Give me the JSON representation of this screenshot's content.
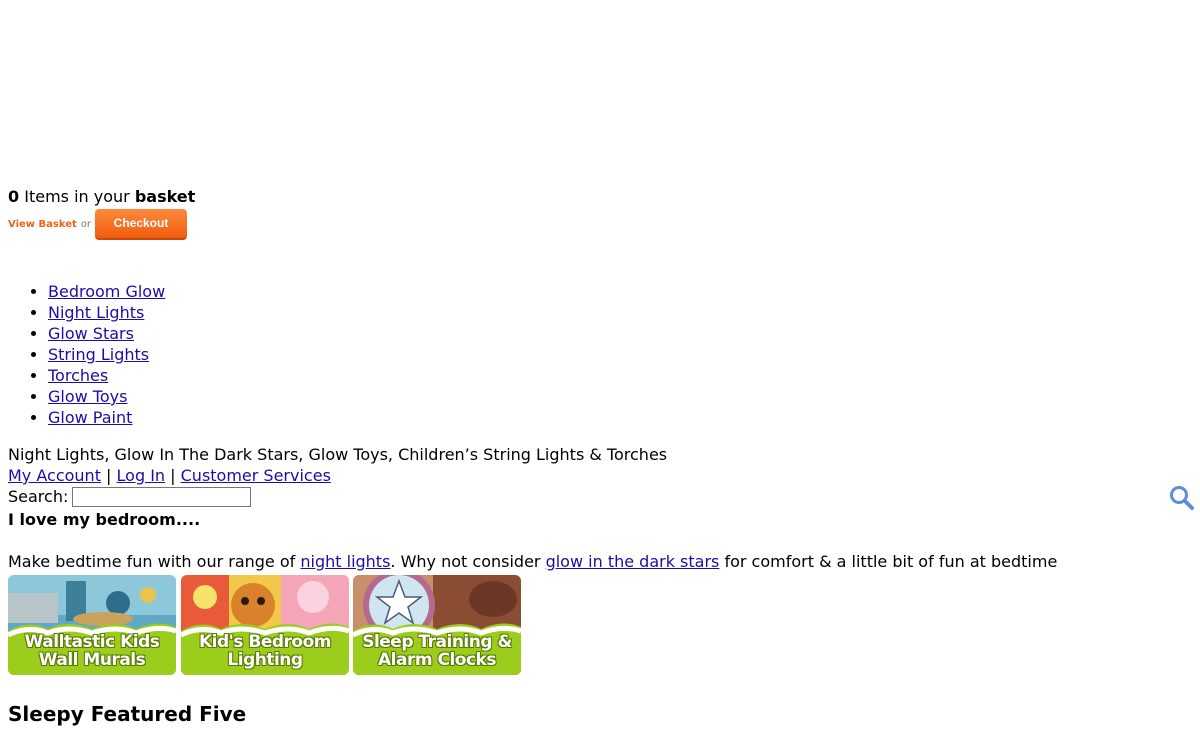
{
  "basket": {
    "count": "0",
    "items_text": " Items in your ",
    "basket_word": "basket",
    "view_basket": "View Basket",
    "or": "or",
    "checkout": "Checkout"
  },
  "nav": {
    "items": [
      "Bedroom Glow",
      "Night Lights",
      "Glow Stars",
      "String Lights",
      "Torches",
      "Glow Toys",
      "Glow Paint"
    ]
  },
  "tagline": "Night Lights, Glow In The Dark Stars, Glow Toys, Children’s String Lights & Torches",
  "account": {
    "my_account": "My Account",
    "separator": " | ",
    "log_in": "Log In",
    "customer_services": "Customer Services"
  },
  "search": {
    "label": "Search:",
    "value": "",
    "icon": "search-icon"
  },
  "intro": {
    "heading": "I love my bedroom....",
    "text_before": "Make bedtime fun with our range of ",
    "link_night_lights": "night lights",
    "text_middle": ". Why not consider ",
    "link_glow_stars": "glow in the dark stars",
    "text_after": " for comfort & a little bit of fun at bedtime"
  },
  "banners": [
    {
      "line1": "Walltastic Kids",
      "line2": "Wall Murals"
    },
    {
      "line1": "Kid's Bedroom",
      "line2": "Lighting"
    },
    {
      "line1": "Sleep Training &",
      "line2": "Alarm Clocks"
    }
  ],
  "featured": {
    "heading": "Sleepy Featured Five"
  },
  "colors": {
    "link": "#1a0dab",
    "checkout": "#f26a1b",
    "banner_green": "#9ccc1c"
  }
}
